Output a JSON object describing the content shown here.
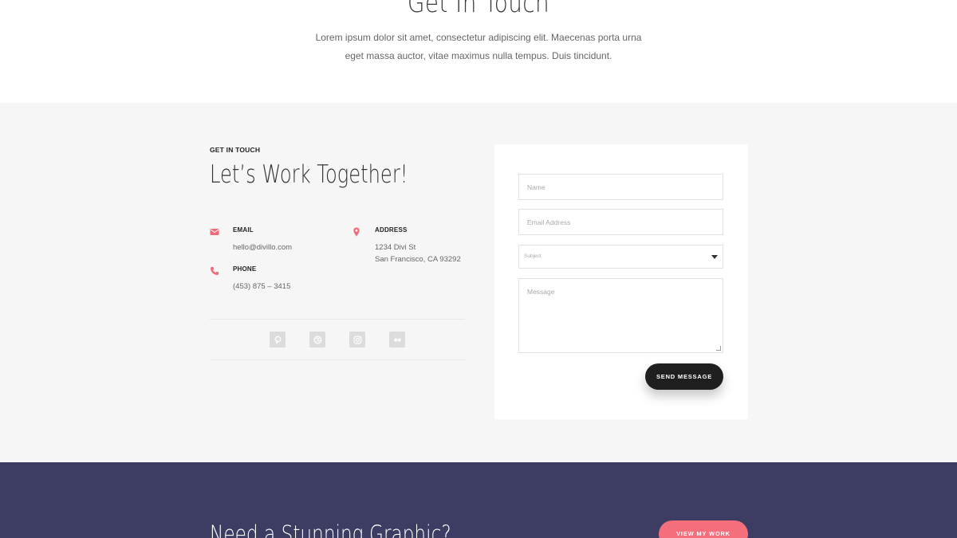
{
  "hero": {
    "title": "Get In Touch",
    "subtitle_line1": "Lorem ipsum dolor sit amet, consectetur adipiscing elit. Maecenas porta urna",
    "subtitle_line2": "eget massa auctor, vitae maximus nulla tempus. Duis tincidunt."
  },
  "contact": {
    "eyebrow": "GET IN TOUCH",
    "title": "Let’s Work Together!",
    "email": {
      "label": "EMAIL",
      "value": "hello@divillo.com",
      "icon": "envelope-icon"
    },
    "phone": {
      "label": "PHONE",
      "value": "(453) 875 – 3415",
      "icon": "phone-icon"
    },
    "address": {
      "label": "ADDRESS",
      "line1": "1234 Divi St",
      "line2": "San Francisco, CA 93292",
      "icon": "map-pin-icon"
    },
    "social": [
      "pinterest-icon",
      "dribbble-icon",
      "instagram-icon",
      "flickr-icon"
    ],
    "accent_color": "#f06b7a"
  },
  "form": {
    "name_placeholder": "Name",
    "email_placeholder": "Email Address",
    "subject_placeholder": "Subject",
    "message_placeholder": "Message",
    "send_label": "SEND MESSAGE"
  },
  "cta": {
    "title": "Need a Stunning Graphic?",
    "button_label": "VIEW MY WORK",
    "background_color": "#3d3c62",
    "button_color": "#f56e7c"
  }
}
